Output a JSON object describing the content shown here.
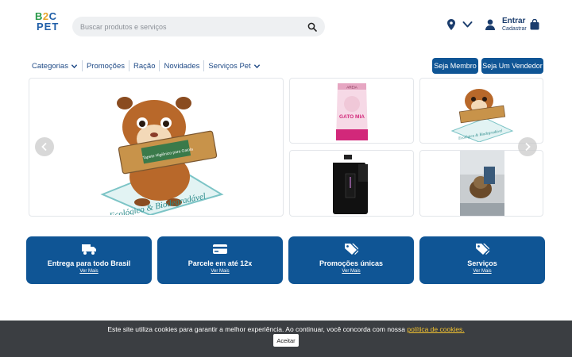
{
  "brand": {
    "logo_line1_b": "B",
    "logo_line1_2": "2",
    "logo_line1_c": "C",
    "logo_line2": "PET"
  },
  "search": {
    "placeholder": "Buscar produtos e serviços"
  },
  "header": {
    "login_label": "Entrar",
    "register_label": "Cadastrar"
  },
  "nav": {
    "items": [
      {
        "label": "Categorias",
        "has_dropdown": true
      },
      {
        "label": "Promoções",
        "has_dropdown": false
      },
      {
        "label": "Ração",
        "has_dropdown": false
      },
      {
        "label": "Novidades",
        "has_dropdown": false
      },
      {
        "label": "Serviços Pet",
        "has_dropdown": true
      }
    ],
    "member_button": "Seja Membro",
    "seller_button": "Seja Um Vendedor"
  },
  "banner": {
    "main_text": "Ecológico & Biodegradável",
    "box_text": "Tapete Higiênico para Gaiola",
    "thumb_product_label": "GATO MIA",
    "thumb_product_brand": "AREIA",
    "thumb_small_text": "Ecológico & Biodegradável"
  },
  "features": [
    {
      "title": "Entrega para todo Brasil",
      "link": "Ver Mais",
      "icon": "truck-icon"
    },
    {
      "title": "Parcele em até 12x",
      "link": "Ver Mais",
      "icon": "credit-card-icon"
    },
    {
      "title": "Promoções únicas",
      "link": "Ver Mais",
      "icon": "tags-icon"
    },
    {
      "title": "Serviços",
      "link": "Ver Mais",
      "icon": "tags-icon"
    }
  ],
  "cookie": {
    "message": "Este site utiliza cookies para garantir a melhor experiência. Ao continuar, você concorda com nossa ",
    "policy_link": "política de cookies.",
    "accept_label": "Aceitar"
  },
  "colors": {
    "primary": "#0f5595",
    "cookie_bg": "#3b3e42",
    "cookie_link": "#f2c230"
  }
}
